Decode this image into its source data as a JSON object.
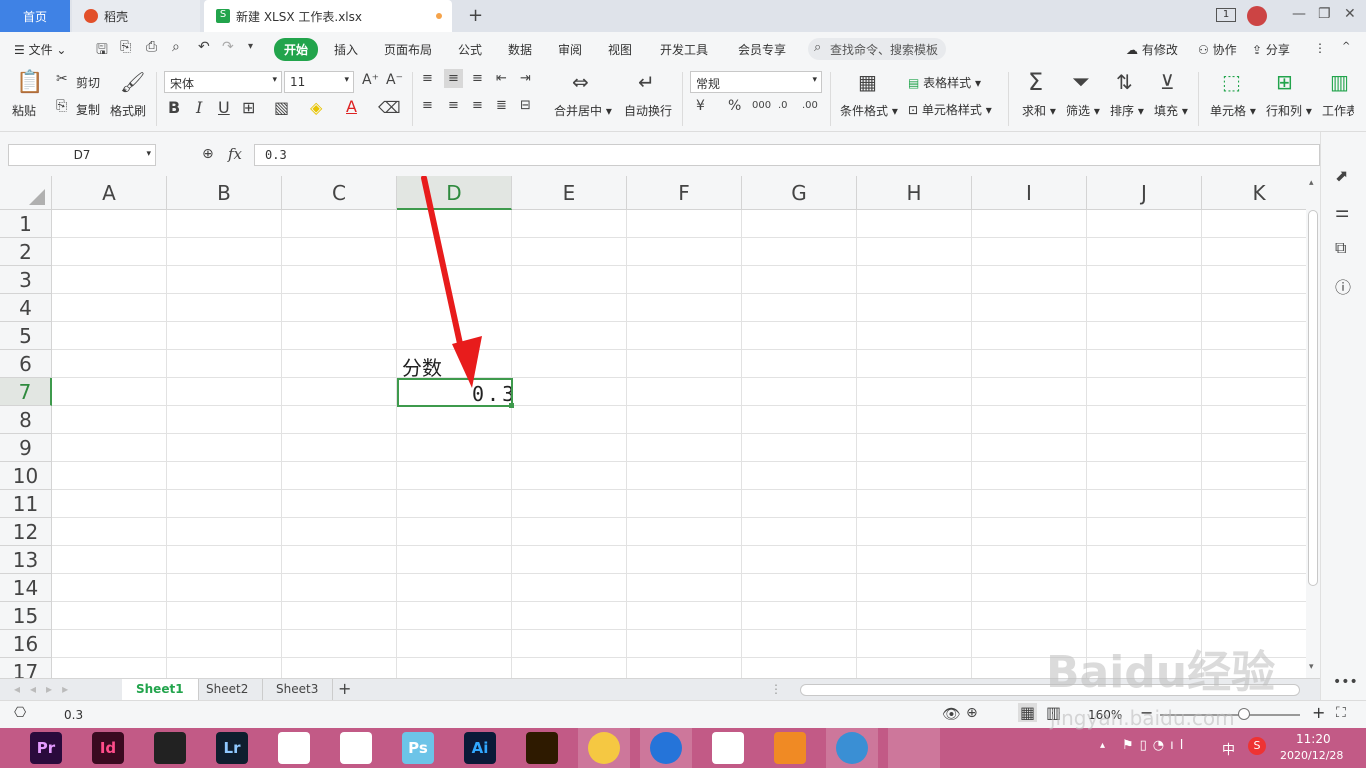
{
  "tabs": {
    "home": "首页",
    "daoke": "稻壳",
    "file": "新建 XLSX 工作表.xlsx",
    "new_tab": "+"
  },
  "titlebar": {
    "page_badge": "1"
  },
  "menu": {
    "file": "文件",
    "start": "开始",
    "insert": "插入",
    "page_layout": "页面布局",
    "formula": "公式",
    "data": "数据",
    "review": "审阅",
    "view": "视图",
    "developer": "开发工具",
    "member": "会员专享",
    "search_placeholder": "查找命令、搜索模板",
    "has_changes": "有修改",
    "collaborate": "协作",
    "share": "分享"
  },
  "ribbon": {
    "paste": "粘贴",
    "cut": "剪切",
    "copy": "复制",
    "format_painter": "格式刷",
    "font_name": "宋体",
    "font_size": "11",
    "merge_center": "合并居中",
    "wrap_text": "自动换行",
    "number_format": "常规",
    "conditional_format": "条件格式",
    "table_style": "表格样式",
    "cell_style": "单元格样式",
    "sum": "求和",
    "filter": "筛选",
    "sort": "排序",
    "fill": "填充",
    "cell": "单元格",
    "row_col": "行和列",
    "worksheet": "工作表",
    "bold": "B",
    "italic": "I",
    "underline": "U",
    "font_color": "A",
    "currency": "¥",
    "percent": "%",
    "thousands": "000",
    "dec_inc": ".0",
    "dec_dec": ".00"
  },
  "formula_bar": {
    "name_box": "D7",
    "fx": "fx",
    "value": "0.3"
  },
  "grid": {
    "columns": [
      "A",
      "B",
      "C",
      "D",
      "E",
      "F",
      "G",
      "H",
      "I",
      "J",
      "K"
    ],
    "rows": [
      "1",
      "2",
      "3",
      "4",
      "5",
      "6",
      "7",
      "8",
      "9",
      "10",
      "11",
      "12",
      "13",
      "14",
      "15",
      "16",
      "17"
    ],
    "cell_d6": "分数",
    "cell_d7": "0.3"
  },
  "sheets": [
    "Sheet1",
    "Sheet2",
    "Sheet3"
  ],
  "status": {
    "value": "0.3",
    "zoom": "160%",
    "zoom_minus": "−",
    "zoom_plus": "+"
  },
  "taskbar": {
    "apps": [
      "Pr",
      "Id",
      "",
      "Lr",
      "",
      "",
      "Ps",
      "Ai",
      "",
      "",
      "",
      "",
      "",
      ""
    ],
    "ime": "中",
    "time": "11:20",
    "date": "2020/12/28"
  },
  "watermark": "Baidu经验 jingyan.baidu.com"
}
